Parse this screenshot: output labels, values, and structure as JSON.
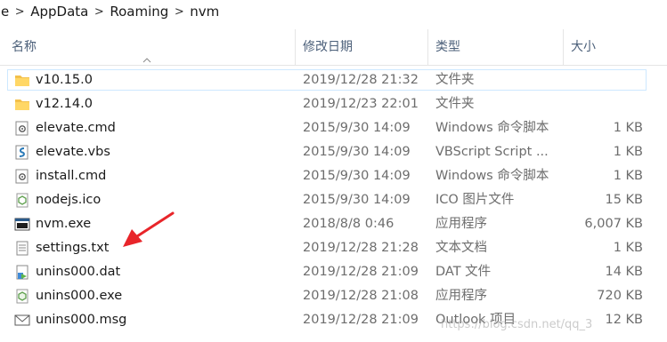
{
  "breadcrumb": {
    "items": [
      "e",
      "AppData",
      "Roaming",
      "nvm"
    ],
    "separator": ">"
  },
  "columns": {
    "name": "名称",
    "date": "修改日期",
    "type": "类型",
    "size": "大小"
  },
  "files": [
    {
      "name": "v10.15.0",
      "date": "2019/12/28 21:32",
      "type": "文件夹",
      "size": "",
      "icon": "folder-icon",
      "selected": true
    },
    {
      "name": "v12.14.0",
      "date": "2019/12/23 22:01",
      "type": "文件夹",
      "size": "",
      "icon": "folder-icon"
    },
    {
      "name": "elevate.cmd",
      "date": "2015/9/30 14:09",
      "type": "Windows 命令脚本",
      "size": "1 KB",
      "icon": "cmd-script-icon"
    },
    {
      "name": "elevate.vbs",
      "date": "2015/9/30 14:09",
      "type": "VBScript Script ...",
      "size": "1 KB",
      "icon": "vbs-script-icon"
    },
    {
      "name": "install.cmd",
      "date": "2015/9/30 14:09",
      "type": "Windows 命令脚本",
      "size": "1 KB",
      "icon": "cmd-script-icon"
    },
    {
      "name": "nodejs.ico",
      "date": "2015/9/30 14:09",
      "type": "ICO 图片文件",
      "size": "15 KB",
      "icon": "nodejs-ico-icon"
    },
    {
      "name": "nvm.exe",
      "date": "2018/8/8 0:46",
      "type": "应用程序",
      "size": "6,007 KB",
      "icon": "exe-icon"
    },
    {
      "name": "settings.txt",
      "date": "2019/12/28 21:28",
      "type": "文本文档",
      "size": "1 KB",
      "icon": "text-file-icon"
    },
    {
      "name": "unins000.dat",
      "date": "2019/12/28 21:09",
      "type": "DAT 文件",
      "size": "14 KB",
      "icon": "dat-file-icon"
    },
    {
      "name": "unins000.exe",
      "date": "2019/12/28 21:08",
      "type": "应用程序",
      "size": "720 KB",
      "icon": "nodejs-exe-icon"
    },
    {
      "name": "unins000.msg",
      "date": "2019/12/28 21:09",
      "type": "Outlook 项目",
      "size": "12 KB",
      "icon": "mail-icon"
    }
  ],
  "watermark": "https://blog.csdn.net/qq_3",
  "colors": {
    "header_text": "#4c607a",
    "secondary_text": "#6d6d6d",
    "folder": "#f3c04a",
    "selection_border": "#cde8ff",
    "arrow": "#e8252a"
  }
}
